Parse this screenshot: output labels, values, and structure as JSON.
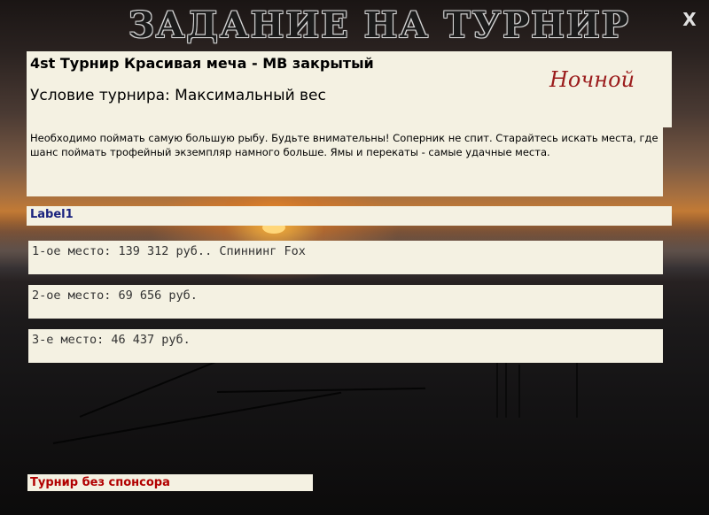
{
  "window": {
    "title": "ЗАДАНИЕ НА ТУРНИР",
    "close_label": "X"
  },
  "tournament": {
    "name": "4st Турнир Красивая меча - MB закрытый",
    "mode": "Ночной",
    "condition": "Условие турнира: Максимальный вес",
    "description": "Необходимо  поймать самую большую рыбу. Будьте внимательны! Соперник не спит. Старайтесь искать места, где шанс поймать трофейный экземпляр намного больше. Ямы и перекаты - самые удачные места."
  },
  "label1": "Label1",
  "prizes": [
    "1-ое место: 139 312 руб.. Спиннинг Fox",
    "2-ое место: 69 656 руб.",
    "3-е место: 46 437 руб."
  ],
  "sponsor_text": "Турнир без спонсора",
  "colors": {
    "panel_bg": "#f4f1e2",
    "mode_color": "#9b1c1c",
    "label_color": "#1a237e",
    "sponsor_color": "#b10000"
  }
}
